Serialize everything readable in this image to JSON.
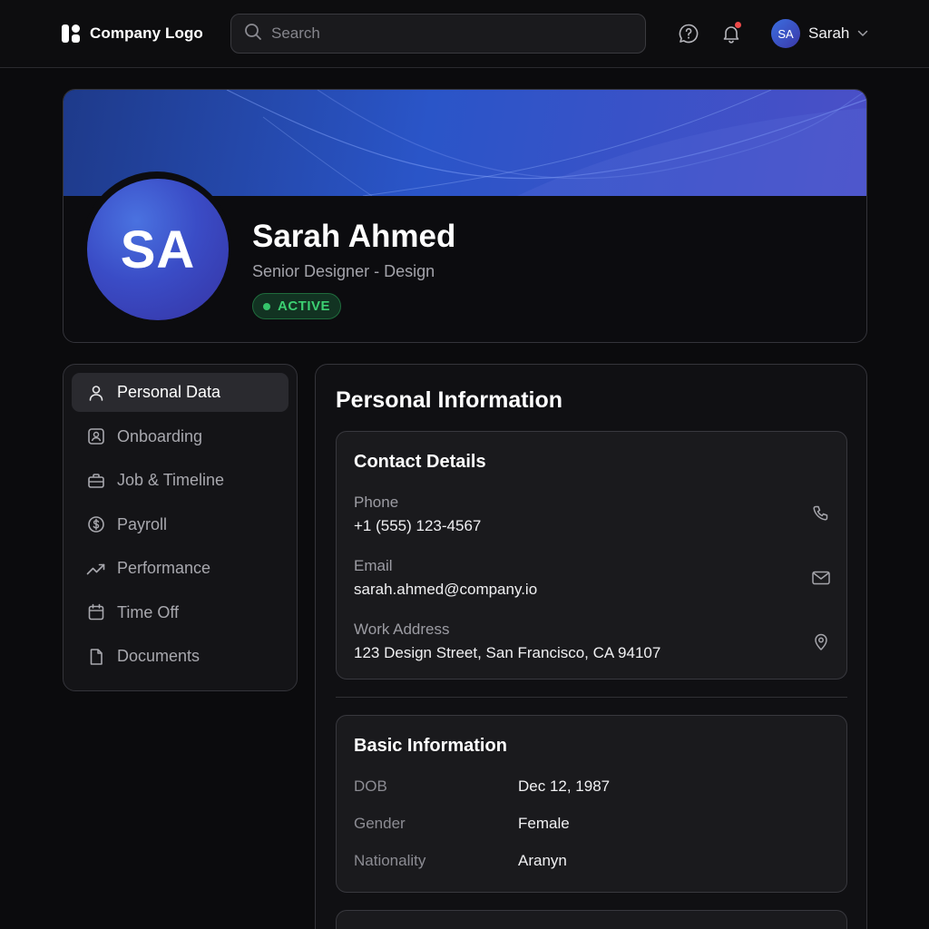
{
  "header": {
    "logo_text": "Company Logo",
    "search_placeholder": "Search",
    "user_initials": "SA",
    "user_name": "Sarah"
  },
  "profile": {
    "initials": "SA",
    "name": "Sarah Ahmed",
    "role": "Senior Designer - Design",
    "status": "ACTIVE"
  },
  "nav": {
    "items": [
      {
        "label": "Personal Data",
        "icon": "user-icon",
        "active": true
      },
      {
        "label": "Onboarding",
        "icon": "id-badge-icon"
      },
      {
        "label": "Job & Timeline",
        "icon": "briefcase-icon"
      },
      {
        "label": "Payroll",
        "icon": "dollar-circle-icon"
      },
      {
        "label": "Performance",
        "icon": "trending-up-icon"
      },
      {
        "label": "Time Off",
        "icon": "calendar-icon"
      },
      {
        "label": "Documents",
        "icon": "document-icon"
      }
    ]
  },
  "main": {
    "title": "Personal Information",
    "contact": {
      "title": "Contact Details",
      "rows": [
        {
          "label": "Phone",
          "value": "+1 (555) 123-4567",
          "icon": "phone-icon"
        },
        {
          "label": "Email",
          "value": "sarah.ahmed@company.io",
          "icon": "mail-icon"
        },
        {
          "label": "Work Address",
          "value": "123 Design Street, San Francisco, CA 94107",
          "icon": "map-pin-icon"
        }
      ]
    },
    "basic": {
      "title": "Basic Information",
      "rows": [
        {
          "label": "DOB",
          "value": "Dec 12, 1987"
        },
        {
          "label": "Gender",
          "value": "Female"
        },
        {
          "label": "Nationality",
          "value": "Aranyn"
        }
      ]
    }
  },
  "colors": {
    "accent": "#3b5bd6",
    "status_green": "#3ccf72",
    "notification": "#ef4a4a"
  }
}
